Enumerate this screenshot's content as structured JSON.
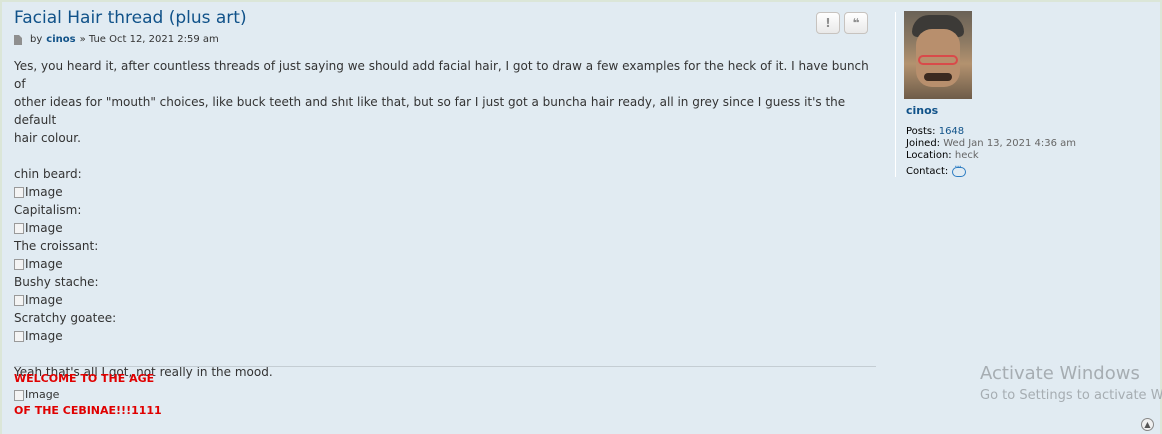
{
  "post": {
    "title": "Facial Hair thread (plus art)",
    "by_label": "by",
    "author": "cinos",
    "date": "» Tue Oct 12, 2021 2:59 am",
    "buttons": {
      "report_icon": "!",
      "quote_icon": "❝"
    },
    "body": {
      "intro_line1": "Yes, you heard it, after countless threads of just saying we should add facial hair, I got to draw a few examples for the heck of it. I have bunch of",
      "intro_line2": "other ideas for \"mouth\" choices, like buck teeth and shıt like that, but so far I just got a buncha hair ready, all in grey since I guess it's the default",
      "intro_line3": "hair colour.",
      "items": [
        {
          "label": "chin beard:",
          "image_alt": "Image"
        },
        {
          "label": "Capitalism:",
          "image_alt": "Image"
        },
        {
          "label": "The croissant:",
          "image_alt": "Image"
        },
        {
          "label": "Bushy stache:",
          "image_alt": "Image"
        },
        {
          "label": "Scratchy goatee:",
          "image_alt": "Image"
        }
      ],
      "outro": "Yeah that's all I got, not really in the mood."
    },
    "signature": {
      "line1": "WELCOME TO THE AGE",
      "image_alt": "Image",
      "line2": "OF THE CEBINAE!!!1111"
    }
  },
  "profile": {
    "username": "cinos",
    "posts_label": "Posts:",
    "posts_value": "1648",
    "joined_label": "Joined:",
    "joined_value": "Wed Jan 13, 2021 4:36 am",
    "location_label": "Location:",
    "location_value": "heck",
    "contact_label": "Contact:"
  },
  "watermark": {
    "line1": "Activate Windows",
    "line2": "Go to Settings to activate W"
  },
  "colors": {
    "link": "#105289",
    "signature_red": "#e00000",
    "post_bg": "#e1ebf2"
  }
}
